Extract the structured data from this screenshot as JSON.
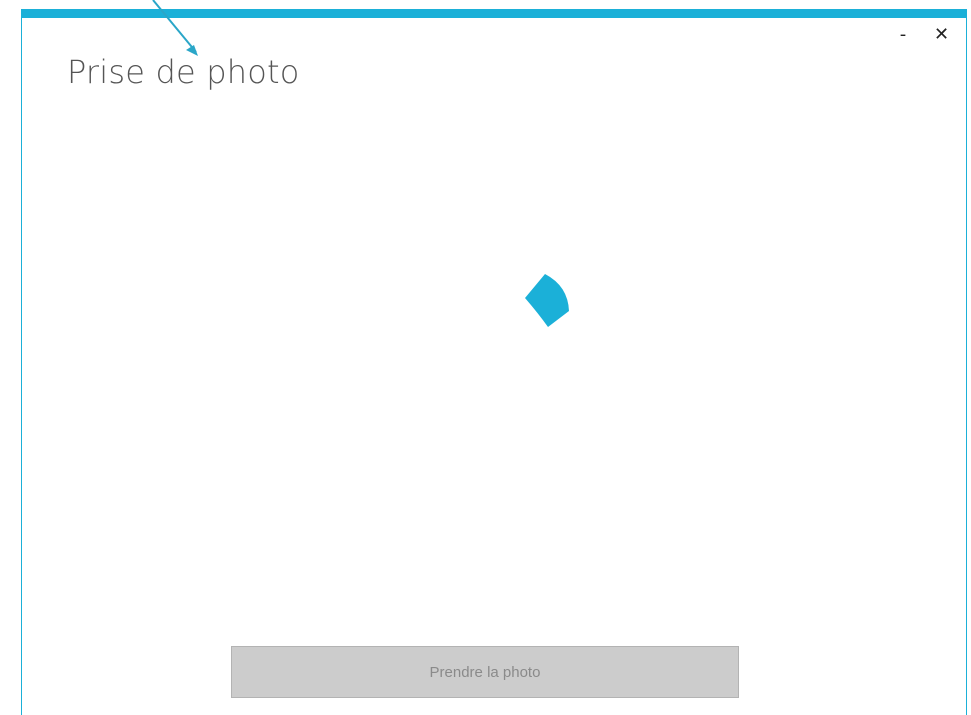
{
  "window": {
    "title": "Prise de photo",
    "minimize_label": "-",
    "close_label": "✕"
  },
  "main": {
    "loading_indicator": "spinner-icon",
    "take_photo_label": "Prendre la photo",
    "take_photo_enabled": false
  },
  "colors": {
    "accent": "#1bb0d8",
    "button_disabled_bg": "#cccccc",
    "button_disabled_text": "#8a8a8a",
    "title_text": "#555555"
  },
  "annotation": {
    "icon": "arrow-pointer-icon"
  }
}
